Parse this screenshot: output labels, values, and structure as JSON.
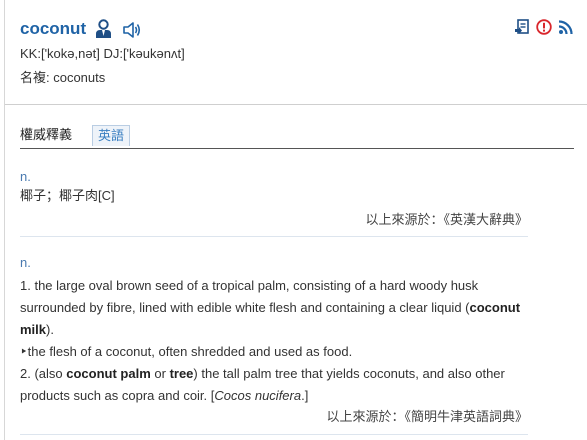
{
  "entry": {
    "headword": "coconut",
    "pron_kk": "KK:['kokə,nət]",
    "pron_dj": "DJ:['kəukənʌt]",
    "plural": "名複: coconuts"
  },
  "icons": {
    "person": "person-icon",
    "sound": "speaker-icon",
    "add": "add-to-list-icon",
    "alert": "alert-icon",
    "rss": "rss-icon",
    "colors": {
      "accent": "#1f63a6",
      "alert": "#d9262c",
      "rss": "#1f63a6"
    }
  },
  "tabs": {
    "active": "權威釋義",
    "english": "英語"
  },
  "sections": [
    {
      "pos": "n.",
      "definition": "椰子；椰子肉[C]",
      "source": "以上來源於：《英漢大辭典》"
    },
    {
      "pos": "n.",
      "def1_a": "1. the large oval brown seed of a tropical palm, consisting of a hard woody husk surrounded by fibre, lined with edible white flesh and containing a clear liquid (",
      "def1_b": "coconut milk",
      "def1_c": ").",
      "def1_sub": "‣the flesh of a coconut, often shredded and used as food.",
      "def2_a": "2. (also ",
      "def2_b": "coconut palm",
      "def2_c": " or ",
      "def2_d": "tree",
      "def2_e": ") the tall palm tree that yields coconuts, and also other products such as copra and coir. [",
      "def2_f": "Cocos nucifera",
      "def2_g": ".]",
      "source": "以上來源於：《簡明牛津英語詞典》"
    }
  ]
}
